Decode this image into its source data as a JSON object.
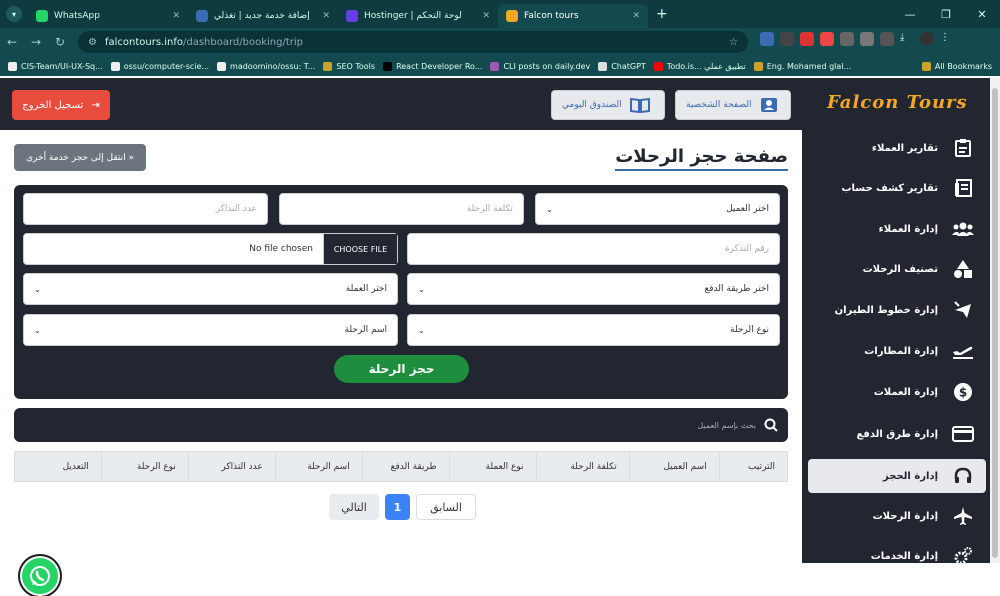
{
  "browser": {
    "tabs": [
      {
        "title": "WhatsApp",
        "color": "#25d366"
      },
      {
        "title": "إضافة خدمة جديد | تغذلي",
        "color": "#3b6bb3"
      },
      {
        "title": "Hostinger | لوحة التحكم",
        "color": "#673de6"
      },
      {
        "title": "Falcon tours",
        "color": "#f5a623"
      }
    ],
    "url_host": "falcontours.info",
    "url_path": "/dashboard/booking/trip",
    "bookmarks": [
      "CIS-Team/UI-UX-Sq...",
      "ossu/computer-scie...",
      "madoomino/ossu: T...",
      "SEO Tools",
      "React Developer Ro...",
      "CLI posts on daily.dev",
      "ChatGPT",
      "Todo.is... تطبيق عملي",
      "Eng. Mohamed glal..."
    ],
    "all_bookmarks": "All Bookmarks"
  },
  "header": {
    "logout_label": "تسجيل الخروج",
    "daily_box_label": "الصندوق اليومي",
    "profile_label": "الصفحة الشخصية"
  },
  "sidebar": {
    "logo": "Falcon Tours",
    "items": [
      {
        "label": "تقارير العملاء",
        "icon": "report-icon"
      },
      {
        "label": "تقارير كشف حساب",
        "icon": "statement-icon"
      },
      {
        "label": "إدارة العملاء",
        "icon": "users-icon"
      },
      {
        "label": "تصنيف الرحلات",
        "icon": "shapes-icon"
      },
      {
        "label": "إدارة خطوط الطيران",
        "icon": "plane-route-icon"
      },
      {
        "label": "إدارة المطارات",
        "icon": "plane-departure-icon"
      },
      {
        "label": "إدارة العملات",
        "icon": "dollar-icon"
      },
      {
        "label": "إدارة طرق الدفع",
        "icon": "card-icon"
      },
      {
        "label": "إدارة الحجز",
        "icon": "headset-icon"
      },
      {
        "label": "إدارة الرحلات",
        "icon": "plane-icon"
      },
      {
        "label": "إدارة الخدمات",
        "icon": "cogs-icon"
      }
    ]
  },
  "main": {
    "title": "صفحة حجز الرحلات",
    "goto_label": "انتقل إلى حجز خدمة أخرى »",
    "form": {
      "customer_select": "اختر العميل",
      "trip_cost_placeholder": "تكلفة الرحلة",
      "tickets_count_placeholder": "عدد التذاكر",
      "ticket_number_placeholder": "رقم التذكرة",
      "file_button": "CHOOSE FILE",
      "file_status": "No file chosen",
      "payment_select": "اختر طريقة الدفع",
      "currency_select": "اختر العملة",
      "trip_type_select": "نوع الرحلة",
      "trip_name_select": "اسم الرحلة",
      "submit_label": "حجز الرحلة"
    },
    "search_placeholder": "بحث بإسم العميل",
    "table_headers": [
      "الترتيب",
      "اسم العميل",
      "تكلفة الرحلة",
      "نوع العملة",
      "طريقة الدفع",
      "اسم الرحلة",
      "عدد التذاكر",
      "نوع الرحلة",
      "التعديل"
    ],
    "pagination": {
      "prev": "السابق",
      "current": "1",
      "next": "التالي"
    }
  }
}
